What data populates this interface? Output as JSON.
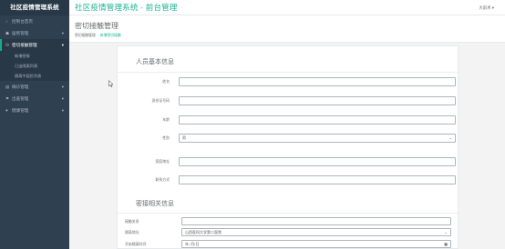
{
  "sidebar": {
    "brand": "社区疫情管理系统",
    "items": [
      {
        "icon": "home-icon",
        "glyph": "⌂",
        "label": "控制台首页",
        "has_chevron": false,
        "active": false
      },
      {
        "icon": "user-group-icon",
        "glyph": "☗",
        "label": "居民管理",
        "has_chevron": true,
        "active": false
      },
      {
        "icon": "contact-icon",
        "glyph": "⚇",
        "label": "密切接触管理",
        "has_chevron": true,
        "active": true
      }
    ],
    "subitems": [
      "新增密接",
      "已出隔离列表",
      "隔离中居民列表"
    ],
    "items_after": [
      {
        "icon": "inventory-icon",
        "glyph": "▤",
        "label": "确诊管理",
        "has_chevron": true
      },
      {
        "icon": "trip-icon",
        "glyph": "⚑",
        "label": "出差管理",
        "has_chevron": true
      },
      {
        "icon": "health-icon",
        "glyph": "♥",
        "label": "健康管理",
        "has_chevron": true
      }
    ]
  },
  "topbar": {
    "title": "社区疫情管理系统 - 前台管理",
    "user": "大前术 ▾"
  },
  "page": {
    "title": "密切接触管理",
    "breadcrumb": {
      "parent": "密切接触管理",
      "current": "新增密切接触"
    }
  },
  "form": {
    "section1_title": "人员基本信息",
    "fields": [
      {
        "label": "姓名",
        "value": "",
        "type": "text"
      },
      {
        "label": "身份证号码",
        "value": "",
        "type": "text"
      },
      {
        "label": "年龄",
        "value": "",
        "type": "text"
      },
      {
        "label": "性别",
        "value": "男",
        "type": "select"
      },
      {
        "label": "家庭地址",
        "value": "",
        "type": "text"
      },
      {
        "label": "联系方式",
        "value": "",
        "type": "text"
      }
    ],
    "section2_title": "密接相关信息",
    "fields2": [
      {
        "label": "接触关系",
        "value": "",
        "type": "text"
      },
      {
        "label": "隔离地址",
        "value": "山西医科大学第二医院",
        "type": "select"
      },
      {
        "label": "开始隔离时间",
        "value": "年 /月/日",
        "type": "date"
      }
    ]
  }
}
